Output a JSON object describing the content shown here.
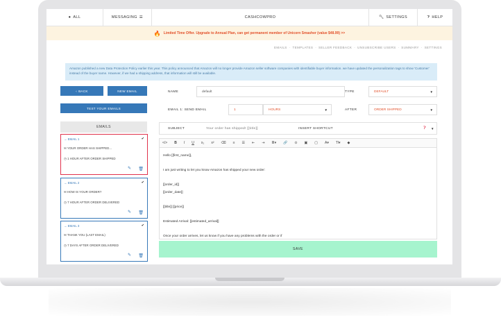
{
  "nav": {
    "all_label": "ALL",
    "messaging_label": "MESSAGING",
    "brand": "CASHCOWPRO",
    "settings_label": "SETTINGS",
    "help_label": "HELP"
  },
  "promo": {
    "text": "Limited Time Offer. Upgrade to Annual Plan, can get permanent member of Unicorn Smasher (value $48.99) >>"
  },
  "subnav": [
    "EMAILS",
    "TEMPLATES",
    "SELLER FEEDBACK",
    "UNSUBSCRIBE USERS",
    "SUMMARY",
    "SETTINGS"
  ],
  "info": {
    "text": "Amazon published a new Data Protection Policy earlier this year. This policy announced that Amazon will no longer provide Amazon seller software companies with identifiable buyer information. we have updated the personalization tags to show 'Customer' instead of the buyer name. However, if we had a shipping address, that information will still be available."
  },
  "sidebar": {
    "back_label": "BACK",
    "new_email_label": "NEW EMAIL",
    "test_label": "TEST YOUR EMAILS",
    "emails_heading": "EMAILS",
    "emails": [
      {
        "title": "EMAIL 1",
        "subject": "YOUR ORDER HAS SHIPPED...",
        "timing": "1 HOUR AFTER ORDER SHIPPED",
        "active": true
      },
      {
        "title": "EMAIL 2",
        "subject": "HOW IS YOUR ORDER?",
        "timing": "7 HOUR AFTER ORDER DELIVERED",
        "active": false
      },
      {
        "title": "EMAIL 3",
        "subject": "THANK YOU (LAST EMAIL)",
        "timing": "7 DAYS AFTER ORDER DELIVERED",
        "active": false
      }
    ]
  },
  "form": {
    "name_label": "NAME",
    "name_value": "default",
    "type_label": "TYPE",
    "type_value": "DEFAULT",
    "send_label": "EMAIL 1: SEND EMAIL",
    "send_number": "1",
    "send_unit": "HOURS",
    "after_label": "AFTER",
    "after_value": "ORDER SHIPPED",
    "subject_label": "SUBJECT",
    "subject_value": "Your order has shipped! [[title]]",
    "shortcut_label": "INSERT SHORTCUT"
  },
  "editor": {
    "toolbar": [
      "</>",
      "B",
      "I",
      "U",
      "x₂",
      "x²",
      "⌫",
      "≡",
      "☰",
      "⇤",
      "⇥",
      "≣▾",
      "🔗",
      "⊙",
      "▣",
      "▢",
      "A▾",
      "Tl▾",
      "◆"
    ],
    "lines": [
      "Hello [[first_name]],",
      "",
      "I am just writing to let you know Amazon has shipped your new order:",
      "",
      "[[order_id]]",
      "[[order_date]]",
      "",
      "[[title]] [[price]]",
      "",
      "Estimated Arrival: [[estimated_arrival]]",
      "",
      "Once your order arrives, let us know if you have any problems with the order or if"
    ]
  },
  "save_label": "SAVE",
  "colors": {
    "primary": "#3678b8",
    "active_border": "#e0314b",
    "save_bg": "#a6f4ce",
    "promo_text": "#e2502a",
    "info_bg": "#d9ecf8"
  }
}
